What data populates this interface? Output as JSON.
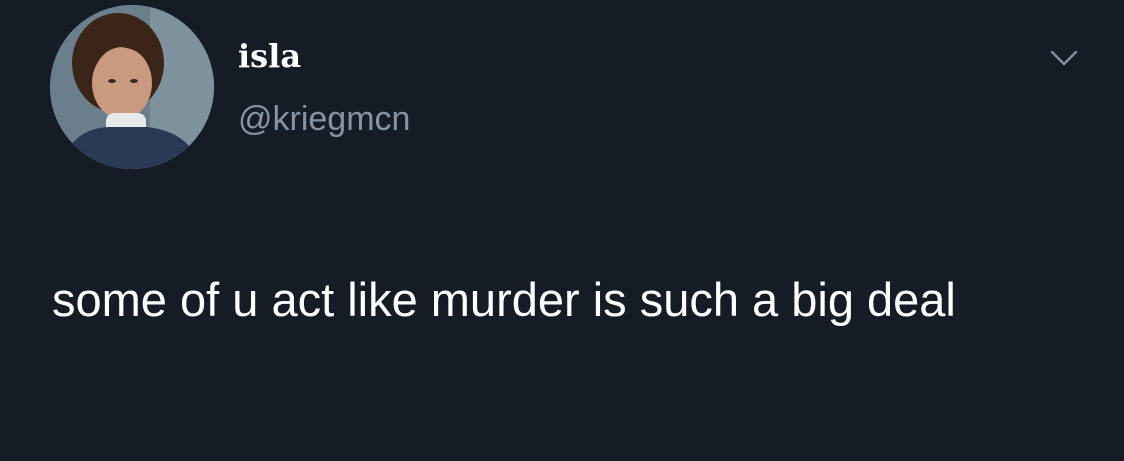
{
  "tweet": {
    "author": {
      "display_name": "isla",
      "handle": "@kriegmcn",
      "avatar_icon": "profile-photo"
    },
    "menu_icon": "chevron-down-icon",
    "text": "some of u act like murder is such a big deal"
  },
  "colors": {
    "background": "#151c26",
    "text_primary": "#ffffff",
    "text_secondary": "#8494a5",
    "chevron": "#7d8e9e"
  }
}
